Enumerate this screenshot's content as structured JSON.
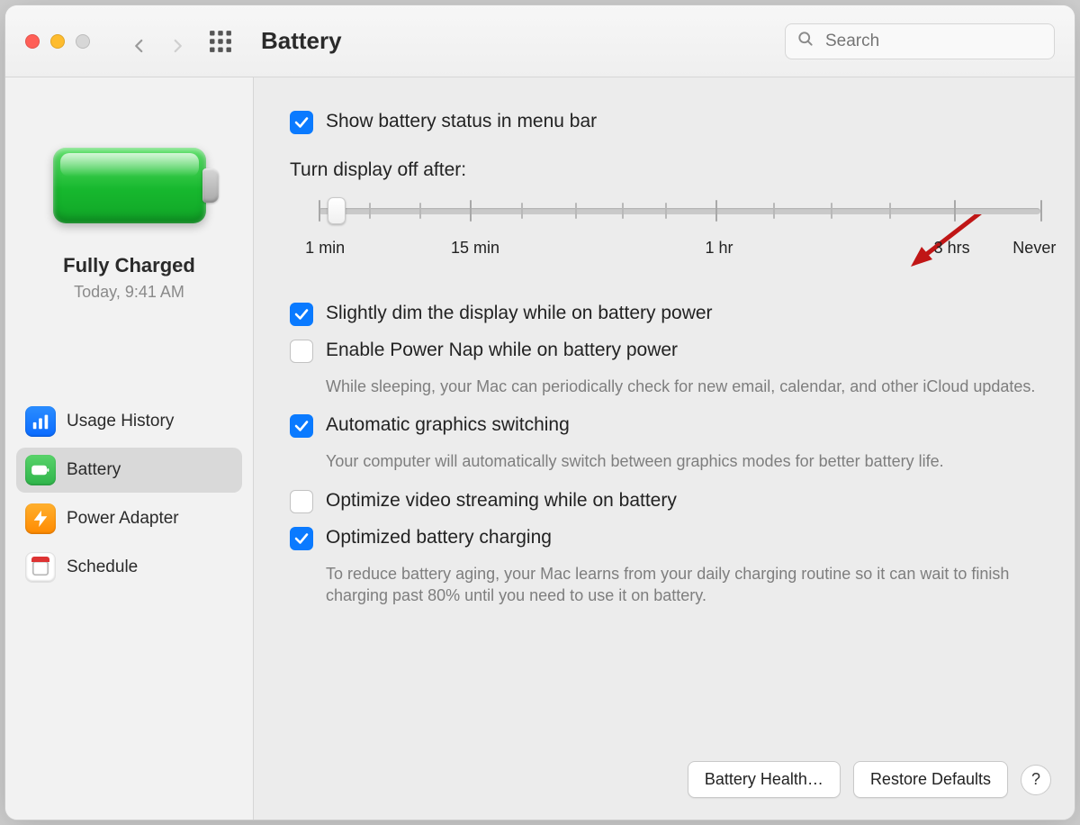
{
  "header": {
    "title": "Battery",
    "search_placeholder": "Search"
  },
  "sidebar": {
    "status_title": "Fully Charged",
    "status_sub": "Today, 9:41 AM",
    "items": [
      {
        "label": "Usage History",
        "icon": "usage-history-icon",
        "selected": false
      },
      {
        "label": "Battery",
        "icon": "battery-icon",
        "selected": true
      },
      {
        "label": "Power Adapter",
        "icon": "power-adapter-icon",
        "selected": false
      },
      {
        "label": "Schedule",
        "icon": "schedule-icon",
        "selected": false
      }
    ]
  },
  "main": {
    "show_status": {
      "label": "Show battery status in menu bar",
      "checked": true
    },
    "display_off_label": "Turn display off after:",
    "slider_labels": [
      "1 min",
      "15 min",
      "1 hr",
      "3 hrs",
      "Never"
    ],
    "options": [
      {
        "label": "Slightly dim the display while on battery power",
        "checked": true
      },
      {
        "label": "Enable Power Nap while on battery power",
        "checked": false,
        "desc": "While sleeping, your Mac can periodically check for new email, calendar, and other iCloud updates."
      },
      {
        "label": "Automatic graphics switching",
        "checked": true,
        "desc": "Your computer will automatically switch between graphics modes for better battery life."
      },
      {
        "label": "Optimize video streaming while on battery",
        "checked": false
      },
      {
        "label": "Optimized battery charging",
        "checked": true,
        "desc": "To reduce battery aging, your Mac learns from your daily charging routine so it can wait to finish charging past 80% until you need to use it on battery."
      }
    ]
  },
  "footer": {
    "battery_health": "Battery Health…",
    "restore_defaults": "Restore Defaults",
    "help": "?"
  }
}
